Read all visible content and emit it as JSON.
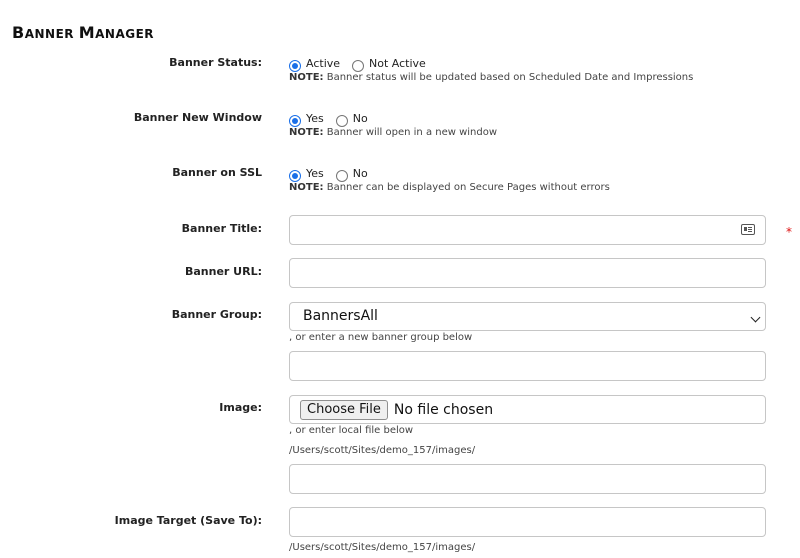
{
  "page": {
    "title_first": "B",
    "title_rest1": "anner ",
    "title_second": "M",
    "title_rest2": "anager"
  },
  "banner_status": {
    "label": "Banner Status:",
    "options": [
      "Active",
      "Not Active"
    ],
    "selected": "Active",
    "note_prefix": "NOTE:",
    "note_text": " Banner status will be updated based on Scheduled Date and Impressions"
  },
  "banner_new_window": {
    "label": "Banner New Window",
    "options": [
      "Yes",
      "No"
    ],
    "selected": "Yes",
    "note_prefix": "NOTE:",
    "note_text": " Banner will open in a new window"
  },
  "banner_ssl": {
    "label": "Banner on SSL",
    "options": [
      "Yes",
      "No"
    ],
    "selected": "Yes",
    "note_prefix": "NOTE:",
    "note_text": " Banner can be displayed on Secure Pages without errors"
  },
  "banner_title": {
    "label": "Banner Title:",
    "value": "",
    "required_mark": "*"
  },
  "banner_url": {
    "label": "Banner URL:",
    "value": ""
  },
  "banner_group": {
    "label": "Banner Group:",
    "selected": "BannersAll",
    "hint": ", or enter a new banner group below",
    "new_group_value": ""
  },
  "image": {
    "label": "Image:",
    "choose_button": "Choose File",
    "file_status": "No file chosen",
    "hint": ", or enter local file below",
    "path": "/Users/scott/Sites/demo_157/images/",
    "local_value": ""
  },
  "image_target": {
    "label": "Image Target (Save To):",
    "value": "",
    "path": "/Users/scott/Sites/demo_157/images/"
  }
}
